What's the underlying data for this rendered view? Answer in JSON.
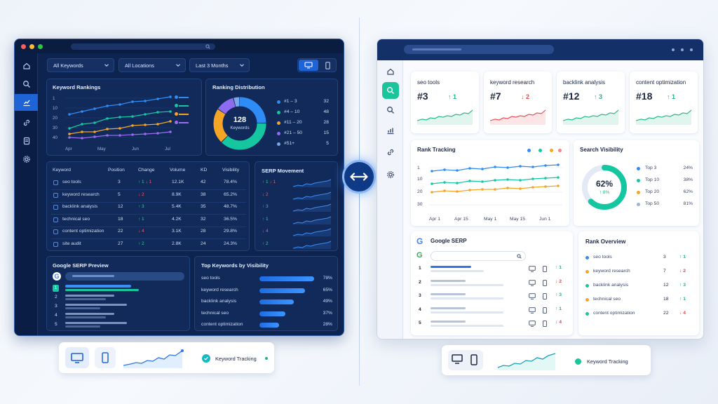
{
  "dark": {
    "filters": {
      "keywords": "All Keywords",
      "locations": "All Locations",
      "period": "Last 3 Months"
    },
    "rankings": {
      "title": "Keyword Rankings",
      "chart_data": {
        "type": "line",
        "x": [
          "Apr",
          "May",
          "Jun",
          "Jul"
        ],
        "y_ticks": [
          "1",
          "10",
          "20",
          "30",
          "40"
        ],
        "series_colors": [
          "#2f8cf5",
          "#14c7a1",
          "#f5a524",
          "#9b6cf0"
        ]
      },
      "x_labels": [
        "Apr",
        "May",
        "Jun",
        "Jul"
      ],
      "y_labels": [
        "1",
        "10",
        "20",
        "30",
        "40"
      ]
    },
    "distribution": {
      "title": "Ranking Distribution",
      "center_value": "128",
      "center_label": "Keywords",
      "chart_data": {
        "type": "pie",
        "labels": [
          "#1 – 3",
          "#4 – 10",
          "#11 – 20",
          "#21 – 50",
          "#51+"
        ],
        "values": [
          32,
          48,
          28,
          15,
          5
        ],
        "colors": [
          "#2f8cf5",
          "#14c7a1",
          "#f5a524",
          "#8e6cf0",
          "#7aa7e8"
        ]
      },
      "rows": [
        {
          "label": "#1 – 3",
          "value": "32"
        },
        {
          "label": "#4 – 10",
          "value": "48"
        },
        {
          "label": "#11 – 20",
          "value": "28"
        },
        {
          "label": "#21 – 50",
          "value": "15"
        },
        {
          "label": "#51+",
          "value": "5"
        }
      ]
    },
    "table": {
      "headers": [
        "Keyword",
        "Position",
        "Change",
        "Volume",
        "KD",
        "Visibility"
      ],
      "rows": [
        {
          "keyword": "seo tools",
          "position": "3",
          "up": "1",
          "down": "1",
          "volume": "12.1K",
          "kd": "42",
          "visibility": "78.4%"
        },
        {
          "keyword": "keyword research",
          "position": "5",
          "up": "",
          "down": "2",
          "volume": "8.9K",
          "kd": "38",
          "visibility": "65.2%"
        },
        {
          "keyword": "backlink analysis",
          "position": "12",
          "up": "3",
          "down": "",
          "volume": "5.4K",
          "kd": "35",
          "visibility": "48.7%"
        },
        {
          "keyword": "technical seo",
          "position": "18",
          "up": "1",
          "down": "",
          "volume": "4.2K",
          "kd": "32",
          "visibility": "36.5%"
        },
        {
          "keyword": "content optimization",
          "position": "22",
          "up": "",
          "down": "4",
          "volume": "3.1K",
          "kd": "28",
          "visibility": "29.8%"
        },
        {
          "keyword": "site audit",
          "position": "27",
          "up": "2",
          "down": "",
          "volume": "2.8K",
          "kd": "24",
          "visibility": "24.3%"
        }
      ]
    },
    "serp_movement": {
      "title": "SERP Movement",
      "rows": [
        {
          "up": "1",
          "down": "1"
        },
        {
          "up": "",
          "down": "2"
        },
        {
          "up": "3",
          "down": ""
        },
        {
          "up": "1",
          "down": ""
        },
        {
          "up": "",
          "down": "4"
        },
        {
          "up": "2",
          "down": ""
        }
      ]
    },
    "serp_preview": {
      "title": "Google SERP Preview",
      "results": [
        "1",
        "2",
        "3",
        "4",
        "5"
      ]
    },
    "top_visibility": {
      "title": "Top Keywords by Visibility",
      "rows": [
        {
          "label": "seo tools",
          "value": "78%",
          "fraction": 0.78
        },
        {
          "label": "keyword research",
          "value": "65%",
          "fraction": 0.65
        },
        {
          "label": "backlink analysis",
          "value": "49%",
          "fraction": 0.49
        },
        {
          "label": "technical seo",
          "value": "37%",
          "fraction": 0.37
        },
        {
          "label": "content optimization",
          "value": "28%",
          "fraction": 0.28
        }
      ]
    }
  },
  "light": {
    "kpis": [
      {
        "title": "seo tools",
        "rank": "#3",
        "arrow": "up",
        "change": "1",
        "color": "#1ab583"
      },
      {
        "title": "keyword research",
        "rank": "#7",
        "arrow": "down",
        "change": "2",
        "color": "#e5484d"
      },
      {
        "title": "backlink analysis",
        "rank": "#12",
        "arrow": "up",
        "change": "3",
        "color": "#1ab583"
      },
      {
        "title": "content optimization",
        "rank": "#18",
        "arrow": "up",
        "change": "1",
        "color": "#1ab583"
      }
    ],
    "rank_tracking": {
      "title": "Rank Tracking",
      "x_labels": [
        "Apr 1",
        "Apr 15",
        "May 1",
        "May 15",
        "Jun 1"
      ],
      "y_labels": [
        "1",
        "10",
        "20",
        "30"
      ],
      "chart_data": {
        "type": "line",
        "x": [
          "Apr 1",
          "Apr 15",
          "May 1",
          "May 15",
          "Jun 1"
        ],
        "y_ticks": [
          "1",
          "10",
          "20",
          "30"
        ],
        "series_colors": [
          "#2f8cf5",
          "#14c7a1",
          "#f5a524"
        ]
      }
    },
    "visibility": {
      "title": "Search Visibility",
      "value": "62%",
      "change": "8%",
      "fraction": 0.62,
      "rows": [
        {
          "label": "Top 3",
          "value": "24%",
          "color": "#2f8cf5"
        },
        {
          "label": "Top 10",
          "value": "38%",
          "color": "#14c7a1"
        },
        {
          "label": "Top 20",
          "value": "62%",
          "color": "#f5a524"
        },
        {
          "label": "Top 50",
          "value": "81%",
          "color": "#9bb3d6"
        }
      ]
    },
    "google_serp": {
      "title": "Google SERP",
      "rows": [
        {
          "n": "1",
          "arrow": "up",
          "change": "1"
        },
        {
          "n": "2",
          "arrow": "down",
          "change": "2"
        },
        {
          "n": "3",
          "arrow": "up",
          "change": "3"
        },
        {
          "n": "4",
          "arrow": "up",
          "change": "1"
        },
        {
          "n": "5",
          "arrow": "down",
          "change": "4"
        }
      ]
    },
    "rank_overview": {
      "title": "Rank Overview",
      "rows": [
        {
          "label": "seo tools",
          "value": "3",
          "arrow": "up",
          "change": "1",
          "color": "#2f8cf5"
        },
        {
          "label": "keyword research",
          "value": "7",
          "arrow": "down",
          "change": "2",
          "color": "#f5a524"
        },
        {
          "label": "backlink analysis",
          "value": "12",
          "arrow": "up",
          "change": "3",
          "color": "#14c7a1"
        },
        {
          "label": "technical seo",
          "value": "18",
          "arrow": "up",
          "change": "1",
          "color": "#f5a524"
        },
        {
          "label": "content optimization",
          "value": "22",
          "arrow": "down",
          "change": "4",
          "color": "#14c7a1"
        }
      ]
    }
  },
  "bottom": {
    "left_label": "Keyword Tracking",
    "right_label": "Keyword Tracking"
  }
}
